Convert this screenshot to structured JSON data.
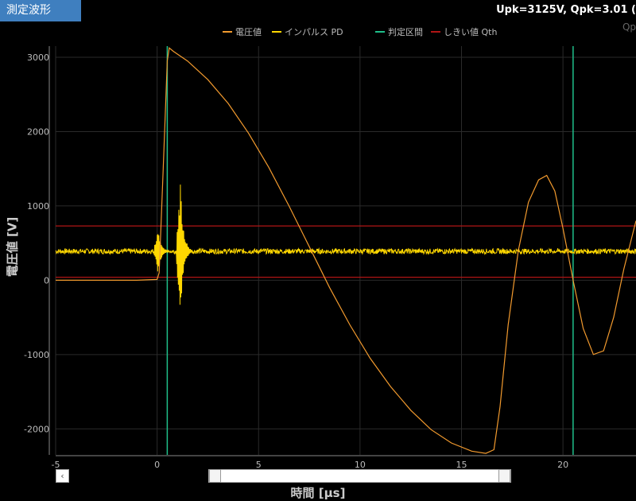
{
  "tab": {
    "label": "測定波形"
  },
  "readout": {
    "text": "Upk=3125V,  Qpk=3.01 (",
    "sub": "Qp"
  },
  "colors": {
    "voltage": "#f29a2e",
    "pd": "#ffd700",
    "window": "#1fbf8a",
    "threshold": "#b01515",
    "grid": "#2a2a2a",
    "axis": "#888"
  },
  "nav": {
    "left_arrow": "‹"
  },
  "slider": {
    "start_fraction": 0.0,
    "end_fraction": 1.0
  },
  "chart_data": {
    "type": "line",
    "xlabel": "時間 [μs]",
    "ylabel": "電圧値 [V]",
    "xlim": [
      -5,
      23.6
    ],
    "ylim": [
      -2350,
      3150
    ],
    "xticks": [
      -5,
      0,
      5,
      10,
      15,
      20
    ],
    "yticks": [
      -2000,
      -1000,
      0,
      1000,
      2000,
      3000
    ],
    "grid": true,
    "legend_position": "top-center",
    "legend": [
      "電圧値",
      "インパルス PD",
      "判定区間",
      "しきい値 Qth"
    ],
    "series": [
      {
        "name": "電圧値",
        "x": [
          -5,
          -3,
          -1,
          0,
          0.1,
          0.3,
          0.5,
          0.6,
          0.8,
          1.5,
          2.5,
          3.5,
          4.5,
          5.5,
          6.5,
          7.5,
          8.5,
          9.5,
          10.5,
          11.5,
          12.5,
          13.5,
          14.5,
          15.5,
          16.2,
          16.6,
          16.9,
          17.3,
          17.8,
          18.3,
          18.8,
          19.2,
          19.6,
          20.0,
          20.5,
          21.0,
          21.5,
          22.0,
          22.5,
          23.0,
          23.6
        ],
        "y": [
          0,
          0,
          0,
          10,
          100,
          1500,
          2950,
          3125,
          3080,
          2950,
          2700,
          2380,
          1980,
          1520,
          1000,
          450,
          -100,
          -600,
          -1050,
          -1430,
          -1750,
          -2010,
          -2190,
          -2300,
          -2330,
          -2280,
          -1700,
          -600,
          400,
          1050,
          1350,
          1410,
          1200,
          700,
          0,
          -650,
          -1000,
          -950,
          -500,
          150,
          800
        ]
      },
      {
        "name": "インパルス PD",
        "baseline": 390,
        "bursts": [
          {
            "x": 0,
            "max": 700,
            "min": 60
          },
          {
            "x": 1.1,
            "max": 1450,
            "min": -600
          }
        ]
      }
    ],
    "window_markers": [
      0.5,
      20.5
    ],
    "threshold_lines": [
      730,
      40
    ]
  },
  "ticks": {
    "x": [
      "-5",
      "0",
      "5",
      "10",
      "15",
      "20"
    ],
    "y": [
      "-2000",
      "-1000",
      "0",
      "1000",
      "2000",
      "3000"
    ]
  }
}
